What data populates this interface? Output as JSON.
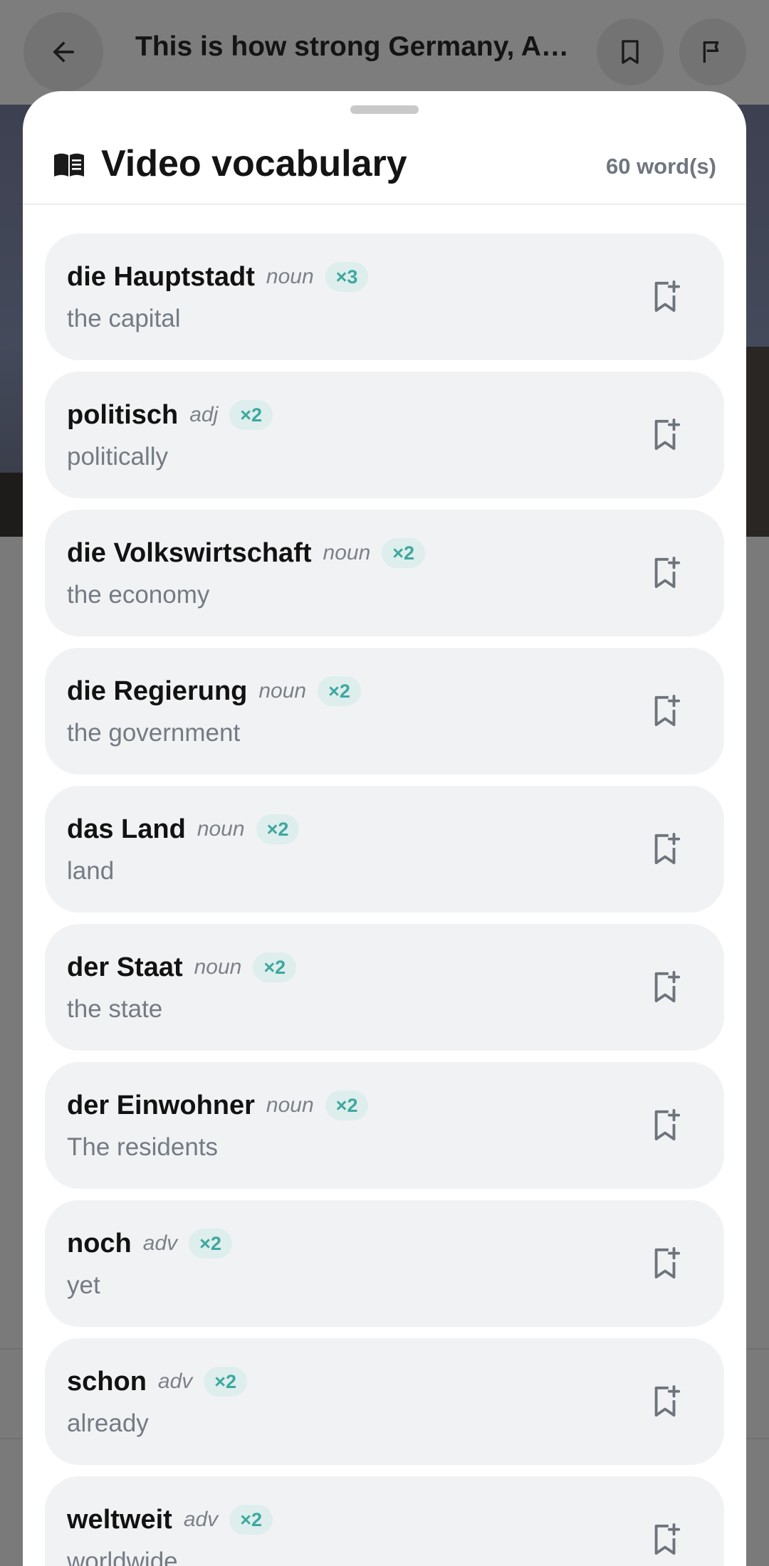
{
  "topbar": {
    "title": "This is how strong Germany, Aus...",
    "back_icon": "arrow-left-icon",
    "bookmark_icon": "bookmark-icon",
    "report_icon": "flag-icon"
  },
  "sheet": {
    "heading": "Video vocabulary",
    "count": "60 word(s)",
    "heading_icon": "book-icon",
    "accent_color": "#3ea89e"
  },
  "words": [
    {
      "term": "die Hauptstadt",
      "pos": "noun",
      "freq": "×3",
      "gloss": "the capital"
    },
    {
      "term": "politisch",
      "pos": "adj",
      "freq": "×2",
      "gloss": "politically"
    },
    {
      "term": "die Volkswirtschaft",
      "pos": "noun",
      "freq": "×2",
      "gloss": "the economy"
    },
    {
      "term": "die Regierung",
      "pos": "noun",
      "freq": "×2",
      "gloss": "the government"
    },
    {
      "term": "das Land",
      "pos": "noun",
      "freq": "×2",
      "gloss": "land"
    },
    {
      "term": "der Staat",
      "pos": "noun",
      "freq": "×2",
      "gloss": "the state"
    },
    {
      "term": "der Einwohner",
      "pos": "noun",
      "freq": "×2",
      "gloss": "The residents"
    },
    {
      "term": "noch",
      "pos": "adv",
      "freq": "×2",
      "gloss": "yet"
    },
    {
      "term": "schon",
      "pos": "adv",
      "freq": "×2",
      "gloss": "already"
    },
    {
      "term": "weltweit",
      "pos": "adv",
      "freq": "×2",
      "gloss": "worldwide"
    }
  ]
}
